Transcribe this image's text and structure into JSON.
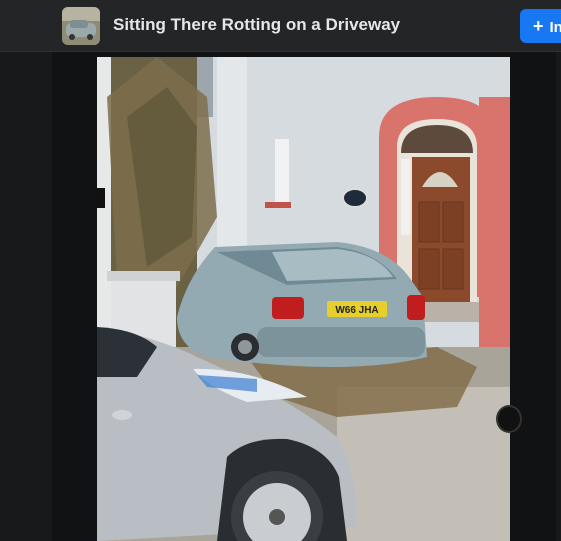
{
  "header": {
    "title": "Sitting There Rotting on a Driveway",
    "cta_icon": "plus-icon",
    "cta_label": "In"
  },
  "photo": {
    "plate_text": "W66 JHA",
    "colors": {
      "wall": "#d6dbe0",
      "brick_arch": "#d9746c",
      "door": "#8b4a2c",
      "car_rover": "#93aab2",
      "car_leaf": "#b9bec4"
    }
  }
}
